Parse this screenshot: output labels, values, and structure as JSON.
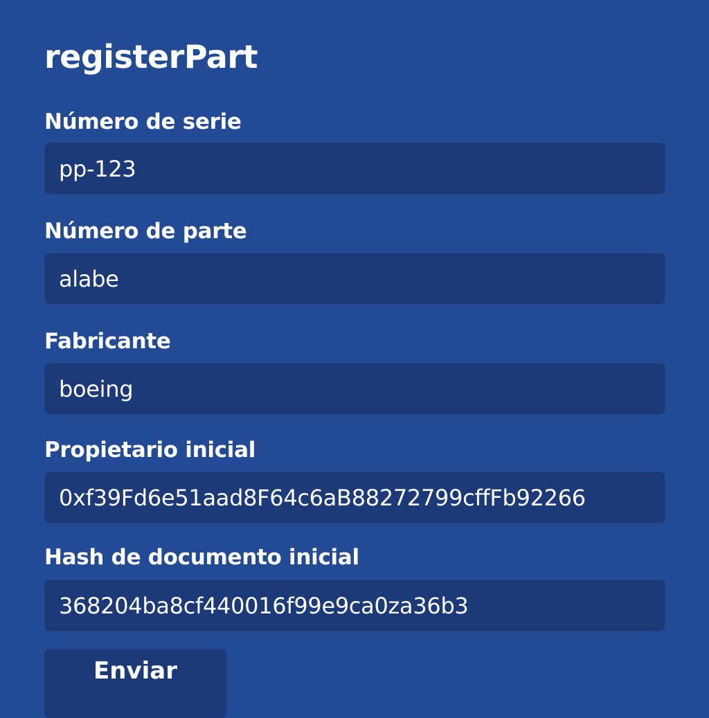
{
  "form": {
    "title": "registerPart",
    "fields": [
      {
        "label": "Número de serie",
        "value": "pp-123"
      },
      {
        "label": "Número de parte",
        "value": "alabe"
      },
      {
        "label": "Fabricante",
        "value": "boeing"
      },
      {
        "label": "Propietario inicial",
        "value": "0xf39Fd6e51aad8F64c6aB88272799cffFb92266"
      },
      {
        "label": "Hash de documento inicial",
        "value": "368204ba8cf440016f99e9ca0za36b3"
      }
    ],
    "submit_label": "Enviar"
  },
  "colors": {
    "background": "#234a94",
    "input_background": "#1c3a78",
    "text": "#ffffff"
  }
}
